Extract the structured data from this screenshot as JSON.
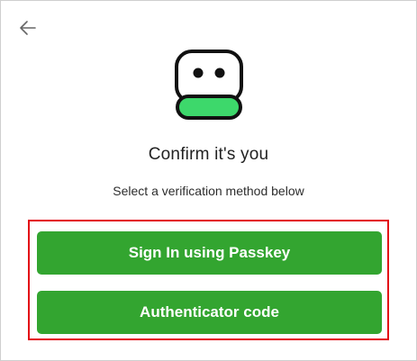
{
  "header": {
    "back_icon": "arrow-left-icon"
  },
  "logo": {
    "icon": "robot-face-logo",
    "colors": {
      "outline": "#111111",
      "face": "#ffffff",
      "base": "#3dd86b"
    }
  },
  "content": {
    "title": "Confirm it's you",
    "subtitle": "Select a verification method below"
  },
  "methods": {
    "passkey_label": "Sign In using Passkey",
    "authenticator_label": "Authenticator code"
  },
  "colors": {
    "button": "#33a530",
    "highlight_border": "#e30613"
  }
}
